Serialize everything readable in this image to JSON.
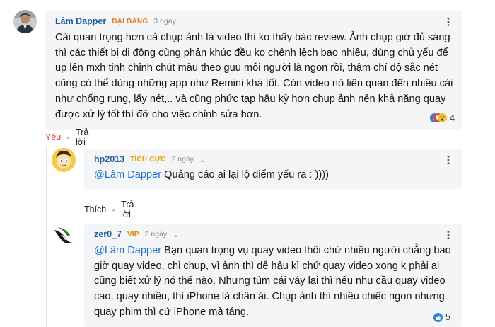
{
  "comments": [
    {
      "username": "Lâm Dapper",
      "badge": "ĐẠI BÀNG",
      "badge_color": "#e9792a",
      "time": "3 ngày",
      "body": "Cái quan trọng hơn cả chụp ảnh là video thì ko thấy bác review. Ảnh chụp giờ đủ sáng thì các thiết bị di động cùng phân khúc đều ko chênh lệch bao nhiêu, dùng chủ yếu để up lên mxh tinh chỉnh chút màu theo guu mỗi người là ngon rồi, thậm chí độ sắc nét cũng có thể dùng những app như Remini khá tốt. Còn video nó liên quan đến nhiều cái như chống rung, lấy nét,.. và cũng phức tạp hậu kỳ hơn chụp ảnh nên khả năng quay được xử lý tốt thì đỡ cho việc chỉnh sửa hơn.",
      "reaction_count": "4",
      "reaction_icons": [
        "like-icon",
        "love-icon",
        "wow-icon"
      ],
      "actions": {
        "primary": "Yêu",
        "primary_color": "#d6303a",
        "reply": "Trả lời"
      }
    },
    {
      "username": "hp2013",
      "badge": "TÍCH CỰC",
      "badge_color": "#e9a100",
      "time": "2 ngày",
      "mention": "@Lâm Dapper",
      "body": " Quảng cáo ai lại lộ điểm yếu ra : ))))",
      "actions": {
        "primary": "Thích",
        "reply": "Trả lời"
      }
    },
    {
      "username": "zer0_7",
      "badge": "VIP",
      "badge_color": "#d58a00",
      "time": "2 ngày",
      "mention": "@Lâm Dapper",
      "body": " Bạn quan trọng vụ quay video thôi chứ nhiều người chẳng bao giờ quay video, chỉ chụp, vì ảnh thì dễ hậu kì chứ quay video xong k phải ai cũng biết xử lý nó thế nào. Nhưng túm cái váy lại thì nếu nhu cầu quay video cao, quay nhiều, thì iPhone là chân ái. Chụp ảnh thì nhiều chiếc ngon nhưng quay phim thì cứ iPhone mà táng.",
      "reaction_count": "5",
      "reaction_icons": [
        "like-icon"
      ]
    }
  ]
}
